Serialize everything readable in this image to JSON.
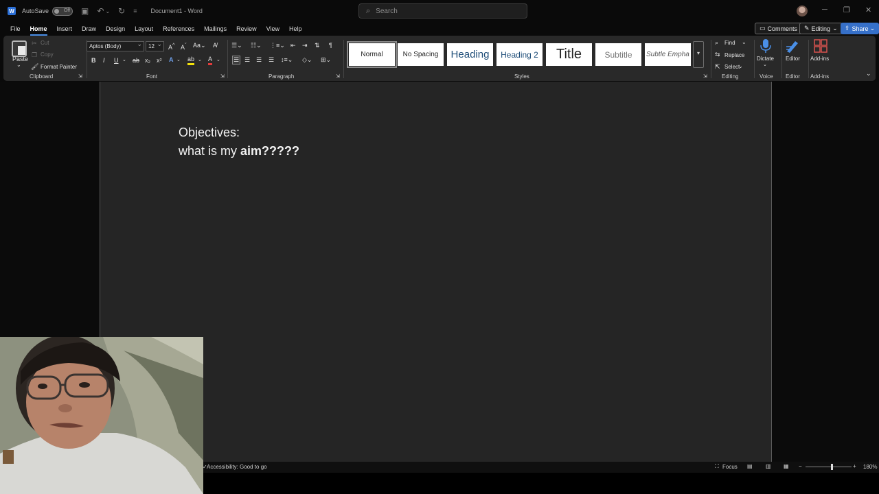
{
  "titlebar": {
    "autosave_label": "AutoSave",
    "autosave_state": "Off",
    "doc_title": "Document1  -  Word",
    "search_placeholder": "Search",
    "logo_letter": "W"
  },
  "menu": {
    "tabs": [
      "File",
      "Home",
      "Insert",
      "Draw",
      "Design",
      "Layout",
      "References",
      "Mailings",
      "Review",
      "View",
      "Help"
    ],
    "active": "Home",
    "comments_label": "Comments",
    "editing_label": "Editing",
    "share_label": "Share"
  },
  "ribbon": {
    "clipboard": {
      "paste": "Paste",
      "cut": "Cut",
      "copy": "Copy",
      "format_painter": "Format Painter",
      "label": "Clipboard"
    },
    "font": {
      "family": "Aptos (Body)",
      "size": "12",
      "label": "Font"
    },
    "paragraph": {
      "label": "Paragraph"
    },
    "styles": {
      "label": "Styles",
      "items": [
        "Normal",
        "No Spacing",
        "Heading",
        "Heading 2",
        "Title",
        "Subtitle",
        "Subtle Empha"
      ]
    },
    "editing": {
      "find": "Find",
      "replace": "Replace",
      "select": "Select",
      "label": "Editing"
    },
    "voice": {
      "dictate": "Dictate",
      "label": "Voice"
    },
    "editor": {
      "editor": "Editor",
      "label": "Editor"
    },
    "addins": {
      "addins": "Add-ins",
      "label": "Add-ins"
    },
    "accent_color": "#4a8fe7"
  },
  "document": {
    "line1": "Objectives:",
    "line2_normal": "what is my ",
    "line2_bold": "aim?????"
  },
  "statusbar": {
    "accessibility": "Accessibility: Good to go",
    "focus": "Focus",
    "zoom": "180%"
  }
}
